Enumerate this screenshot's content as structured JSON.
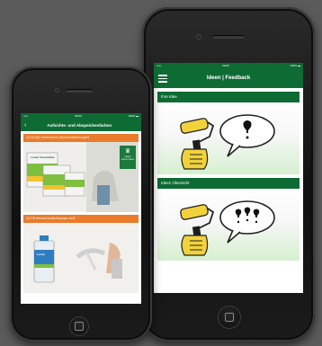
{
  "back_phone": {
    "status": {
      "left": "•••••",
      "time": "09:00",
      "right": "100% ▬"
    },
    "nav": {
      "title": "Ideen | Feedback",
      "menu_icon": "menu-icon"
    },
    "cards": [
      {
        "header": "Ihre Idee",
        "bubble_icon": "single-dot"
      },
      {
        "header": "Ideen Übersicht",
        "bubble_icon": "three-dots"
      }
    ]
  },
  "front_phone": {
    "status": {
      "left": "•••••",
      "time": "09:00",
      "right": "100% ▬"
    },
    "nav": {
      "title": "Aufsichts- und Abspeichenfarben",
      "back_icon": "chevron-left-icon"
    },
    "ads": [
      {
        "header": "(1) InDi(2) Innenräume (Tennismarkierungen)",
        "product_label": "Lorem Tennisfarbe",
        "badge_line1": "Lorem",
        "badge_line2": "Lorem ipsum"
      },
      {
        "header": "(2) DS Aerosol Aufsichtsprays weiß",
        "product_label": "Lorem"
      }
    ]
  },
  "colors": {
    "accent_green": "#0e6b34",
    "accent_orange": "#e97b2a",
    "roller_yellow": "#f2d23a"
  }
}
